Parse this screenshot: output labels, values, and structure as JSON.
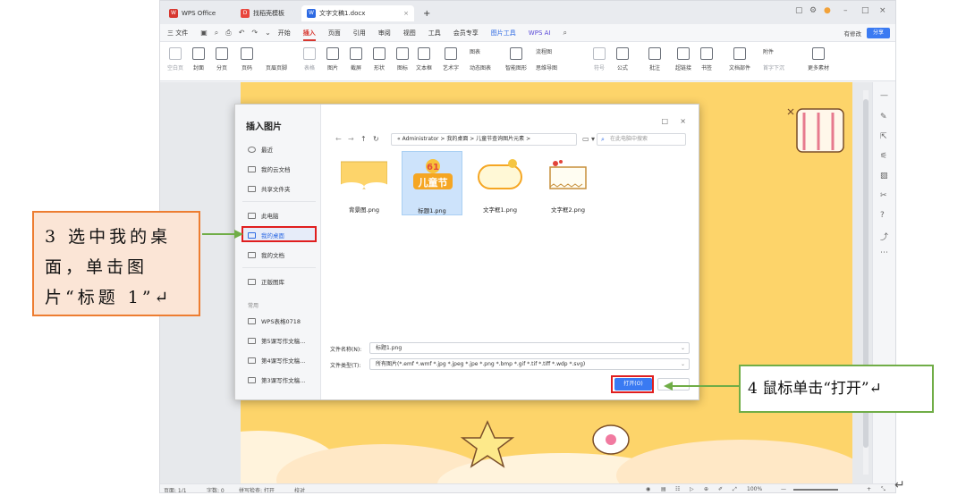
{
  "titlebar": {
    "app_tab": "WPS Office",
    "template_tab": "找稻壳模板",
    "doc_tab": "文字文稿1.docx",
    "add_tab": "+"
  },
  "menubar": {
    "file": "三 文件",
    "items": [
      "开始",
      "插入",
      "页面",
      "引用",
      "审阅",
      "视图",
      "工具",
      "会员专享",
      "图片工具"
    ],
    "active": "插入",
    "wps_ai": "WPS AI",
    "modified": "有修改",
    "share": "分享"
  },
  "ribbon": {
    "items": [
      {
        "label": "空白页",
        "dim": true
      },
      {
        "label": "封面"
      },
      {
        "label": "分页"
      },
      {
        "label": "页码"
      },
      {
        "label": "表格",
        "dim": true
      },
      {
        "label": "图片"
      },
      {
        "label": "截屏"
      },
      {
        "label": "形状"
      },
      {
        "label": "图标"
      },
      {
        "label": "文本框"
      },
      {
        "label": "艺术字"
      },
      {
        "label": "动态图表"
      },
      {
        "label": "智能图形"
      },
      {
        "label": "思维导图"
      },
      {
        "label": "符号",
        "dim": true
      },
      {
        "label": "公式"
      },
      {
        "label": "批注"
      },
      {
        "label": "超链接"
      },
      {
        "label": "书签"
      },
      {
        "label": "文档部件"
      },
      {
        "label": "首字下沉",
        "dim": true
      },
      {
        "label": "更多素材"
      }
    ],
    "extra": {
      "page_header": "页眉页脚",
      "chart": "图表",
      "flowchart": "流程图",
      "attachment": "附件"
    }
  },
  "dialog": {
    "title": "插入图片",
    "nav": {
      "recent": "最近",
      "cloud": "我的云文档",
      "shared": "共享文件夹",
      "this_pc": "此电脑",
      "desktop": "我的桌面",
      "documents": "我的文档",
      "gallery": "正版图库",
      "common_heading": "常用",
      "common": [
        "WPS表格0718",
        "第5课写作文稿...",
        "第4课写作文稿...",
        "第3课写作文稿..."
      ]
    },
    "address": "« Administrator  >  我的桌面  >  儿童节查询图片元素  >",
    "search_placeholder": "在此电脑中搜索",
    "files": [
      {
        "name": "背景图.png"
      },
      {
        "name": "标题1.png"
      },
      {
        "name": "文字框1.png"
      },
      {
        "name": "文字框2.png"
      }
    ],
    "title_badge": "61",
    "title_art": "儿童节",
    "filename_label": "文件名称(N):",
    "filename_value": "标题1.png",
    "filetype_label": "文件类型(T):",
    "filetype_value": "所有图片(*.emf *.wmf *.jpg *.jpeg *.jpe *.png *.bmp *.gif *.tif *.tiff *.wdp *.svg)",
    "open_button": "打开(O)"
  },
  "statusbar": {
    "page": "页面: 1/1",
    "words": "字数: 0",
    "spell": "拼写检查: 打开",
    "proof": "校对",
    "zoom": "100%"
  },
  "annotations": {
    "step3": "3 选中我的桌面，单击图片“标题 1”↵",
    "step4": "4 鼠标单击“打开”↵"
  },
  "colors": {
    "accent": "#2d6ae3",
    "active_menu": "#d7372f",
    "page_bg": "#fdd46a",
    "callout3_border": "#ed7d31",
    "callout4_border": "#70ad47",
    "highlight": "#e01e1e"
  }
}
